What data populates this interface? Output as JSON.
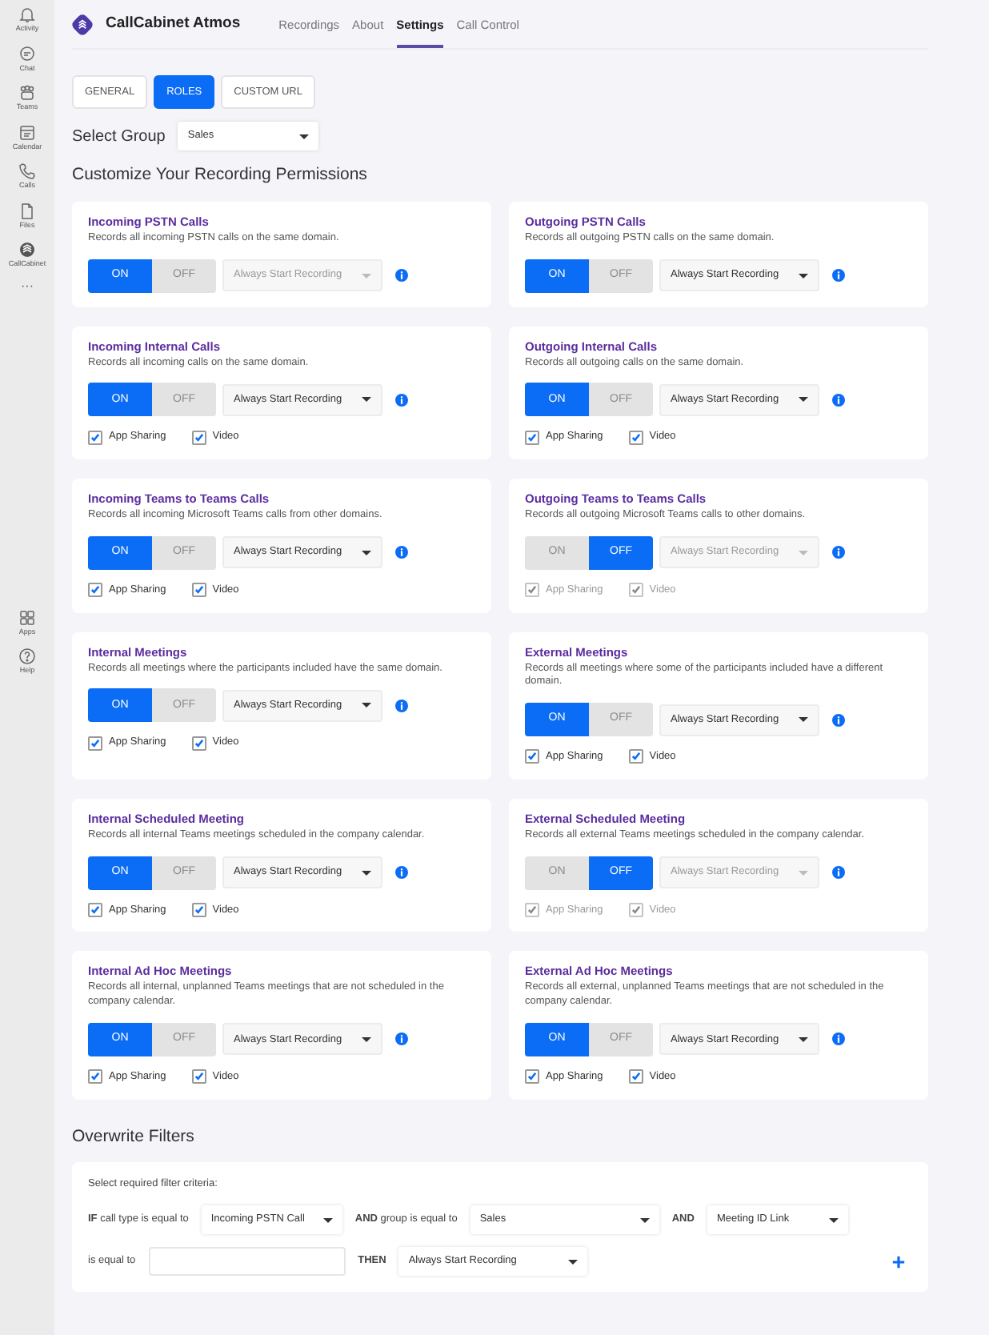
{
  "sidebar": {
    "items": [
      {
        "kind": "bell",
        "label": "Activity"
      },
      {
        "kind": "chat",
        "label": "Chat"
      },
      {
        "kind": "teams",
        "label": "Teams"
      },
      {
        "kind": "calendar",
        "label": "Calendar"
      },
      {
        "kind": "phone",
        "label": "Calls"
      },
      {
        "kind": "file",
        "label": "Files"
      },
      {
        "kind": "logo",
        "label": "CallCabinet"
      },
      {
        "kind": "more",
        "label": "···"
      }
    ],
    "bottom_items": [
      {
        "kind": "apps",
        "label": "Apps"
      },
      {
        "kind": "help",
        "label": "Help"
      }
    ]
  },
  "app": {
    "title": "CallCabinet Atmos"
  },
  "nav": [
    {
      "label": "Recordings",
      "selected": false
    },
    {
      "label": "About",
      "selected": false
    },
    {
      "label": "Settings",
      "selected": true
    },
    {
      "label": "Call Control",
      "selected": false
    }
  ],
  "subtabs": [
    {
      "label": "GENERAL",
      "selected": false
    },
    {
      "label": "ROLES",
      "selected": true
    },
    {
      "label": "CUSTOM URL",
      "selected": false
    }
  ],
  "group_select": {
    "label": "Select Group",
    "value": "Sales"
  },
  "heading": "Customize Your Recording Permissions",
  "permissions": [
    {
      "title": "Incoming PSTN Calls",
      "description": "Records all incoming PSTN calls on the same domain.",
      "on": true,
      "on_label": "ON",
      "off_label": "OFF",
      "mode": {
        "value": "Always Start Recording",
        "disabled": true
      }
    },
    {
      "title": "Outgoing PSTN Calls",
      "description": "Records all outgoing PSTN calls on the same domain.",
      "on": true,
      "on_label": "ON",
      "off_label": "OFF",
      "mode": {
        "value": "Always Start Recording",
        "disabled": false
      }
    },
    {
      "title": "Incoming Internal Calls",
      "description": "Records all incoming calls on the same domain.",
      "on": true,
      "on_label": "ON",
      "off_label": "OFF",
      "mode": {
        "value": "Always Start Recording",
        "disabled": false
      },
      "options": [
        {
          "label": "App Sharing",
          "checked": true,
          "disabled": false
        },
        {
          "label": "Video",
          "checked": true,
          "disabled": false
        }
      ]
    },
    {
      "title": "Outgoing Internal Calls",
      "description": "Records all outgoing calls on the same domain.",
      "on": true,
      "on_label": "ON",
      "off_label": "OFF",
      "mode": {
        "value": "Always Start Recording",
        "disabled": false
      },
      "options": [
        {
          "label": "App Sharing",
          "checked": true,
          "disabled": false
        },
        {
          "label": "Video",
          "checked": true,
          "disabled": false
        }
      ]
    },
    {
      "title": "Incoming Teams to Teams Calls",
      "description": "Records all incoming Microsoft Teams calls from other domains.",
      "on": true,
      "on_label": "ON",
      "off_label": "OFF",
      "mode": {
        "value": "Always Start Recording",
        "disabled": false
      },
      "options": [
        {
          "label": "App Sharing",
          "checked": true,
          "disabled": false
        },
        {
          "label": "Video",
          "checked": true,
          "disabled": false
        }
      ]
    },
    {
      "title": "Outgoing Teams to Teams Calls",
      "description": "Records all outgoing Microsoft Teams calls to other domains.",
      "on": false,
      "on_label": "ON",
      "off_label": "OFF",
      "mode": {
        "value": "Always Start Recording",
        "disabled": true
      },
      "options": [
        {
          "label": "App Sharing",
          "checked": true,
          "disabled": true
        },
        {
          "label": "Video",
          "checked": true,
          "disabled": true
        }
      ]
    },
    {
      "title": "Internal Meetings",
      "description": "Records all meetings where the participants included have the same domain.",
      "on": true,
      "on_label": "ON",
      "off_label": "OFF",
      "mode": {
        "value": "Always Start Recording",
        "disabled": false
      },
      "options": [
        {
          "label": "App Sharing",
          "checked": true,
          "disabled": false
        },
        {
          "label": "Video",
          "checked": true,
          "disabled": false
        }
      ]
    },
    {
      "title": "External Meetings",
      "description": "Records all meetings where some of the participants included have a different domain.",
      "on": true,
      "on_label": "ON",
      "off_label": "OFF",
      "mode": {
        "value": "Always Start Recording",
        "disabled": false
      },
      "options": [
        {
          "label": "App Sharing",
          "checked": true,
          "disabled": false
        },
        {
          "label": "Video",
          "checked": true,
          "disabled": false
        }
      ]
    },
    {
      "title": "Internal Scheduled Meeting",
      "description": "Records all internal Teams meetings scheduled in the company calendar.",
      "on": true,
      "on_label": "ON",
      "off_label": "OFF",
      "mode": {
        "value": "Always Start Recording",
        "disabled": false
      },
      "options": [
        {
          "label": "App Sharing",
          "checked": true,
          "disabled": false
        },
        {
          "label": "Video",
          "checked": true,
          "disabled": false
        }
      ]
    },
    {
      "title": "External Scheduled Meeting",
      "description": "Records all external Teams meetings scheduled in the company calendar.",
      "on": false,
      "on_label": "ON",
      "off_label": "OFF",
      "mode": {
        "value": "Always Start Recording",
        "disabled": true
      },
      "options": [
        {
          "label": "App Sharing",
          "checked": true,
          "disabled": true
        },
        {
          "label": "Video",
          "checked": true,
          "disabled": true
        }
      ]
    },
    {
      "title": "Internal Ad Hoc Meetings",
      "description": "Records all internal, unplanned Teams meetings that are not scheduled in the company calendar.",
      "on": true,
      "on_label": "ON",
      "off_label": "OFF",
      "mode": {
        "value": "Always Start Recording",
        "disabled": false
      },
      "options": [
        {
          "label": "App Sharing",
          "checked": true,
          "disabled": false
        },
        {
          "label": "Video",
          "checked": true,
          "disabled": false
        }
      ]
    },
    {
      "title": "External Ad Hoc Meetings",
      "description": "Records all external, unplanned Teams meetings that are not scheduled in the company calendar.",
      "on": true,
      "on_label": "ON",
      "off_label": "OFF",
      "mode": {
        "value": "Always Start Recording",
        "disabled": false
      },
      "options": [
        {
          "label": "App Sharing",
          "checked": true,
          "disabled": false
        },
        {
          "label": "Video",
          "checked": true,
          "disabled": false
        }
      ]
    }
  ],
  "filters": {
    "heading": "Overwrite Filters",
    "hint": "Select required filter criteria:",
    "rows": [
      [
        {
          "kind": "text",
          "text": "**IF** call type is equal to"
        },
        {
          "kind": "select",
          "value": "Incoming PSTN Call"
        },
        {
          "kind": "text",
          "text": "**AND** group is equal to"
        },
        {
          "kind": "select",
          "value": "Sales"
        },
        {
          "kind": "keyword",
          "text": "AND"
        },
        {
          "kind": "select",
          "value": "Meeting ID Link"
        }
      ],
      [
        {
          "kind": "text",
          "text": "is equal to"
        },
        {
          "kind": "input"
        },
        {
          "kind": "keyword",
          "text": "THEN"
        },
        {
          "kind": "select",
          "value": "Always Start Recording"
        },
        {
          "kind": "add"
        }
      ]
    ]
  }
}
